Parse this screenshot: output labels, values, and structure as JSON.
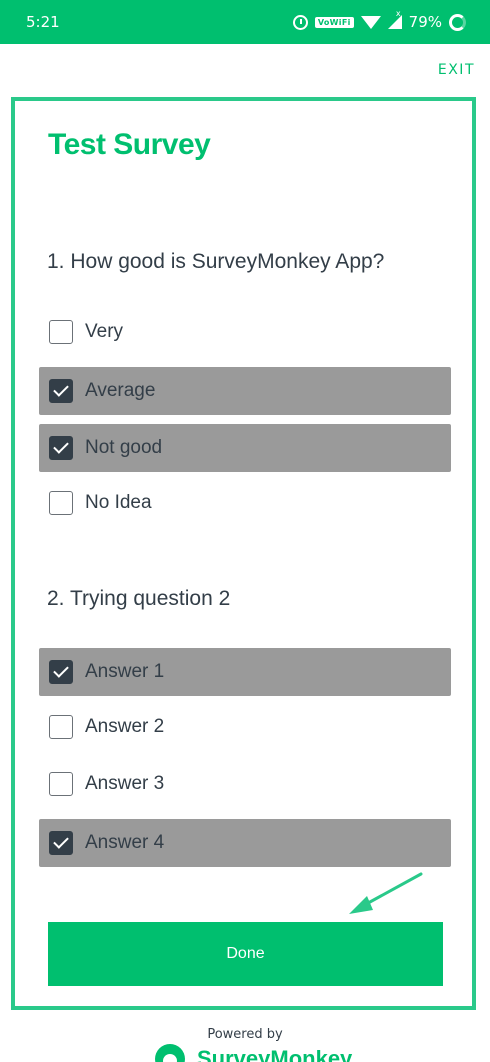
{
  "status_bar": {
    "time": "5:21",
    "vowifi": "VoWiFi",
    "signal_mark": "x",
    "battery": "79%"
  },
  "header": {
    "exit_label": "EXIT"
  },
  "survey": {
    "title": "Test Survey",
    "questions": [
      {
        "text": "1. How good is SurveyMonkey App?",
        "options": [
          {
            "label": "Very",
            "checked": false
          },
          {
            "label": "Average",
            "checked": true
          },
          {
            "label": "Not good",
            "checked": true
          },
          {
            "label": "No Idea",
            "checked": false
          }
        ]
      },
      {
        "text": "2. Trying question 2",
        "options": [
          {
            "label": "Answer 1",
            "checked": true
          },
          {
            "label": "Answer 2",
            "checked": false
          },
          {
            "label": "Answer 3",
            "checked": false
          },
          {
            "label": "Answer 4",
            "checked": true
          }
        ]
      }
    ],
    "done_label": "Done"
  },
  "footer": {
    "powered_by": "Powered by",
    "brand": "SurveyMonkey"
  },
  "colors": {
    "brand_green": "#00bf6f",
    "selected_row": "#9a9a9a",
    "text_dark": "#333e48"
  }
}
